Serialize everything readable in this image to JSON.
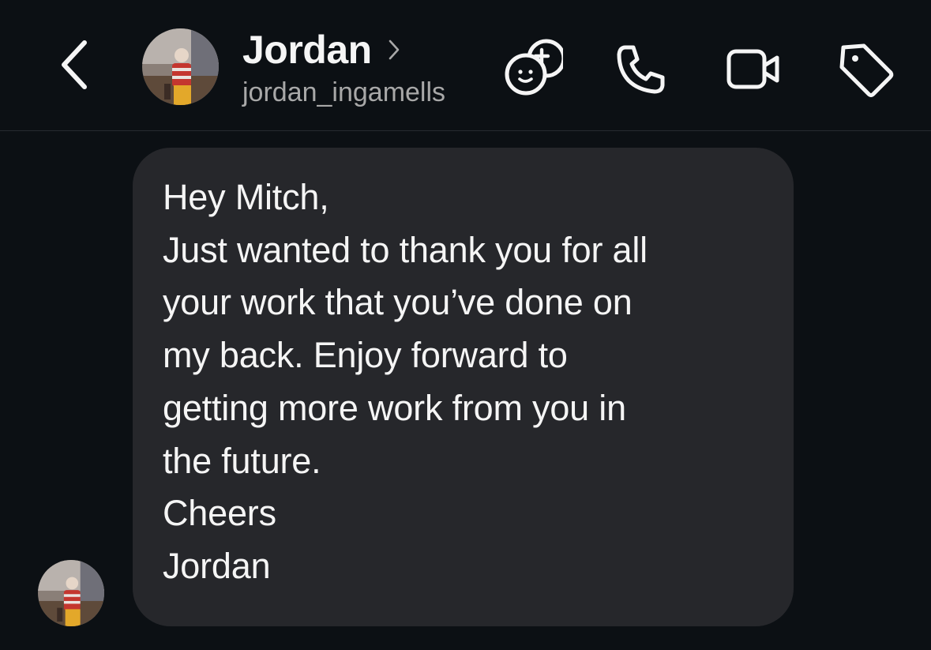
{
  "header": {
    "contact_name": "Jordan",
    "username": "jordan_ingamells",
    "icons": {
      "back": "back-chevron-icon",
      "name_chevron": "chevron-right-icon",
      "add_people": "add-people-icon",
      "call": "phone-icon",
      "video": "video-camera-icon",
      "tag": "tag-icon"
    }
  },
  "conversation": {
    "messages": [
      {
        "sender": "Jordan",
        "lines": [
          "Hey Mitch,",
          "Just wanted to thank you for all",
          "your work that you’ve done on",
          "my back. Enjoy forward to",
          "getting more work from you in",
          "the future.",
          "Cheers",
          "Jordan"
        ]
      }
    ]
  },
  "colors": {
    "background": "#0c1014",
    "bubble": "#26272b",
    "text": "#f5f5f5",
    "secondary_text": "#a8a8a8"
  }
}
